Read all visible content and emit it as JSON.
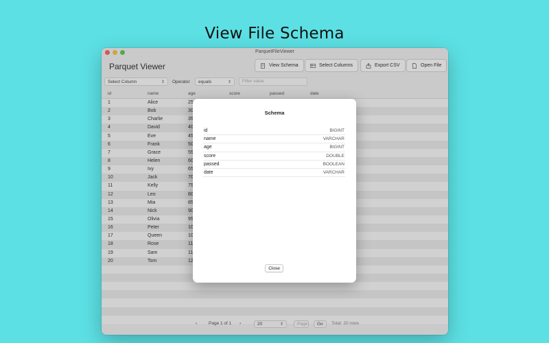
{
  "headline": "View File Schema",
  "window": {
    "title": "ParquetFileViewer",
    "app_title": "Parquet Viewer"
  },
  "toolbar": {
    "view_schema": "View Schema",
    "select_columns": "Select Columns",
    "export_csv": "Export CSV",
    "open_file": "Open File"
  },
  "filter": {
    "column_select": "Select Column",
    "operator_label": "Operator",
    "operator_value": "equals",
    "value_placeholder": "Filter value"
  },
  "table": {
    "headers": [
      "id",
      "name",
      "age",
      "score",
      "passed",
      "date"
    ],
    "rows": [
      {
        "id": "1",
        "name": "Alice",
        "age": "25"
      },
      {
        "id": "2",
        "name": "Bob",
        "age": "30"
      },
      {
        "id": "3",
        "name": "Charlie",
        "age": "35"
      },
      {
        "id": "4",
        "name": "David",
        "age": "40"
      },
      {
        "id": "5",
        "name": "Eve",
        "age": "45"
      },
      {
        "id": "6",
        "name": "Frank",
        "age": "50"
      },
      {
        "id": "7",
        "name": "Grace",
        "age": "55"
      },
      {
        "id": "8",
        "name": "Helen",
        "age": "60"
      },
      {
        "id": "9",
        "name": "Ivy",
        "age": "65"
      },
      {
        "id": "10",
        "name": "Jack",
        "age": "70"
      },
      {
        "id": "11",
        "name": "Kelly",
        "age": "75"
      },
      {
        "id": "12",
        "name": "Leo",
        "age": "80"
      },
      {
        "id": "13",
        "name": "Mia",
        "age": "85"
      },
      {
        "id": "14",
        "name": "Nick",
        "age": "90"
      },
      {
        "id": "15",
        "name": "Olivia",
        "age": "95"
      },
      {
        "id": "16",
        "name": "Peter",
        "age": "10"
      },
      {
        "id": "17",
        "name": "Queen",
        "age": "10"
      },
      {
        "id": "18",
        "name": "Rose",
        "age": "11"
      },
      {
        "id": "19",
        "name": "Sam",
        "age": "11"
      },
      {
        "id": "20",
        "name": "Tom",
        "age": "12"
      }
    ]
  },
  "footer": {
    "prev": "‹",
    "page_text": "Page 1 of 1",
    "next": "›",
    "page_size": "20",
    "page_input_placeholder": "Page",
    "go": "Go",
    "total": "Total: 20 rows"
  },
  "schema_modal": {
    "title": "Schema",
    "fields": [
      {
        "name": "id",
        "type": "BIGINT"
      },
      {
        "name": "name",
        "type": "VARCHAR"
      },
      {
        "name": "age",
        "type": "BIGINT"
      },
      {
        "name": "score",
        "type": "DOUBLE"
      },
      {
        "name": "passed",
        "type": "BOOLEAN"
      },
      {
        "name": "date",
        "type": "VARCHAR"
      }
    ],
    "close_label": "Close"
  }
}
